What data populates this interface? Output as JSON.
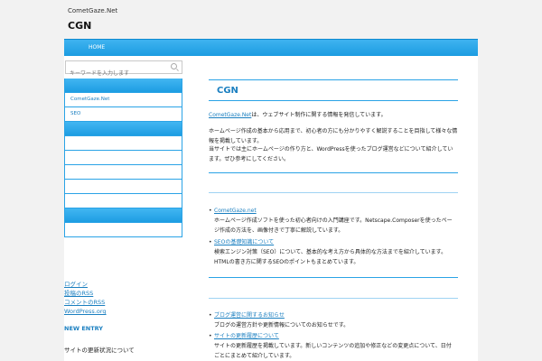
{
  "header": {
    "description": "CometGaze.Net",
    "title": "CGN"
  },
  "nav": {
    "home": "HOME"
  },
  "search": {
    "placeholder": "キーワードを入力します"
  },
  "sidebar": {
    "items": [
      "CometGaze.Net",
      "SEO"
    ],
    "links": [
      "ログイン",
      "投稿のRSS",
      "コメントのRSS",
      "WordPress.org"
    ],
    "new_entry_label": "NEW ENTRY",
    "entry_1": "サイトの更新状況について"
  },
  "main": {
    "title": "CGN",
    "intro_link": "CometGaze.Net",
    "intro_text": "は、ウェブサイト制作に関する情報を発信しています。",
    "para2": "ホームページ作成の基本から応用まで、初心者の方にも分かりやすく解説することを目指して様々な情報を掲載しています。",
    "para3": "当サイトでは主にホームページの作り方と、WordPressを使ったブログ運営などについて紹介しています。ぜひ参考にしてください。",
    "list1": [
      {
        "link": "CometGaze.net",
        "text": "ホームページ作成ソフトを使った初心者向けの入門講座です。Netscape.Composerを使ったページ作成の方法を、画像付きで丁寧に解説しています。"
      },
      {
        "link": "SEOの基礎知識について",
        "text": "検索エンジン対策（SEO）について、基本的な考え方から具体的な方法までを紹介しています。HTMLの書き方に関するSEOのポイントもまとめています。"
      }
    ],
    "list2": [
      {
        "link": "ブログ運営に関するお知らせ",
        "text": "ブログの運営方針や更新情報についてのお知らせです。"
      },
      {
        "link": "サイトの更新履歴について",
        "text": "サイトの更新履歴を掲載しています。新しいコンテンツの追加や修正などの変更点について、日付ごとにまとめて紹介しています。"
      }
    ]
  },
  "colors": {
    "accent": "#1a9be0",
    "link": "#1a7fc0",
    "background": "#f2f2f2"
  }
}
